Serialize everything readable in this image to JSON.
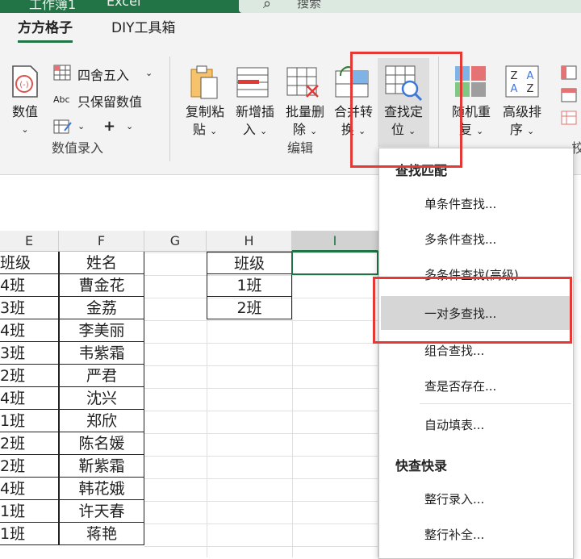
{
  "titlebar": {
    "workbook": "工作簿1",
    "app": "Excel",
    "search_placeholder": "搜索"
  },
  "ribbon": {
    "tabs": [
      {
        "label": "方方格子"
      },
      {
        "label": "DIY工具箱"
      }
    ],
    "numeric_group": {
      "value_btn": "数值",
      "round_label": "四舍五入",
      "round_prefix": "Abc",
      "keep_value_label": "只保留数值",
      "plus": "+",
      "group_label": "数值录入"
    },
    "edit_group": {
      "copy_paste": [
        "复制粘",
        "贴"
      ],
      "insert": [
        "新增插",
        "入"
      ],
      "batch_delete": [
        "批量删",
        "除"
      ],
      "merge_convert": [
        "合并转",
        "换"
      ],
      "find_locate": [
        "查找定",
        "位"
      ],
      "group_label": "编辑"
    },
    "right_group": {
      "random_repeat": [
        "随机重",
        "复"
      ],
      "advanced_sort": [
        "高级排",
        "序"
      ],
      "cut_label": "校"
    }
  },
  "sheet": {
    "columns": [
      "E",
      "F",
      "G",
      "H",
      "I"
    ],
    "selected_column": "I",
    "cursor_glyph": "I",
    "table_e_f": [
      [
        "班级",
        "姓名"
      ],
      [
        "4班",
        "曹金花"
      ],
      [
        "3班",
        "金荔"
      ],
      [
        "4班",
        "李美丽"
      ],
      [
        "3班",
        "韦紫霜"
      ],
      [
        "2班",
        "严君"
      ],
      [
        "4班",
        "沈兴"
      ],
      [
        "1班",
        "郑欣"
      ],
      [
        "2班",
        "陈名媛"
      ],
      [
        "2班",
        "靳紫霜"
      ],
      [
        "4班",
        "韩花娥"
      ],
      [
        "1班",
        "许天春"
      ],
      [
        "1班",
        "蒋艳"
      ]
    ],
    "table_h": [
      "班级",
      "1班",
      "2班"
    ]
  },
  "menu": {
    "section1": "查找匹配",
    "items1": [
      "单条件查找...",
      "多条件查找...",
      "多条件查找(高级)...",
      "一对多查找...",
      "组合查找...",
      "查是否存在..."
    ],
    "item_fill": "自动填表...",
    "section2": "快查快录",
    "items2": [
      "整行录入...",
      "整行补全..."
    ],
    "highlighted": "一对多查找..."
  },
  "colors": {
    "accent": "#217346",
    "highlight_box": "#e53935",
    "ribbon_bg": "#f3f3f3"
  }
}
